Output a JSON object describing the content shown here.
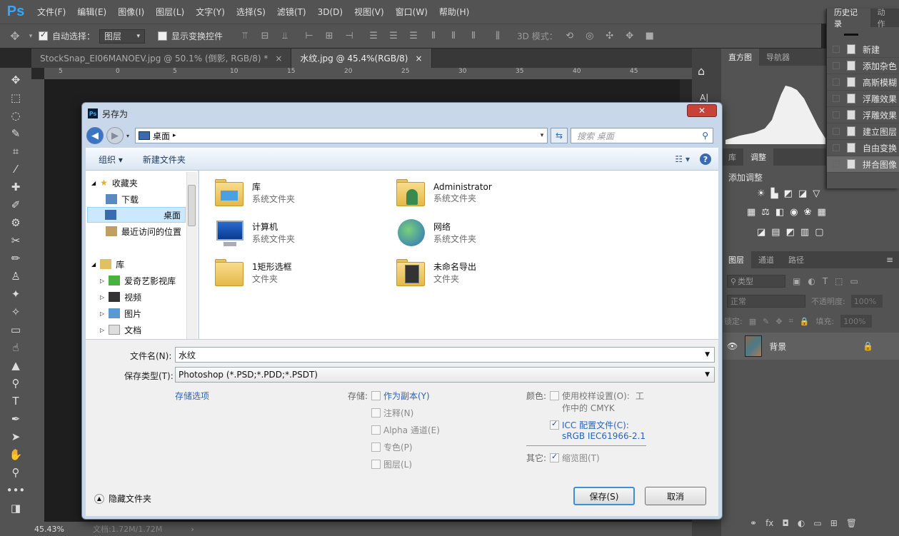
{
  "app": {
    "logo": "Ps"
  },
  "menu": [
    "文件(F)",
    "编辑(E)",
    "图像(I)",
    "图层(L)",
    "文字(Y)",
    "选择(S)",
    "滤镜(T)",
    "3D(D)",
    "视图(V)",
    "窗口(W)",
    "帮助(H)"
  ],
  "options": {
    "auto_select_label": "自动选择：",
    "auto_select_value": "图层",
    "show_transform_label": "显示变换控件",
    "mode_3d_label": "3D 模式："
  },
  "tabs": [
    {
      "title": "StockSnap_EI06MANOEV.jpg @ 50.1% (倒影, RGB/8) *"
    },
    {
      "title": "水纹.jpg @ 45.4%(RGB/8)"
    }
  ],
  "ruler": [
    "5",
    "0",
    "5",
    "10",
    "15",
    "20",
    "25",
    "30",
    "35",
    "40",
    "45"
  ],
  "status": {
    "zoom": "45.43%",
    "doc": "文档:1.72M/1.72M"
  },
  "panels": {
    "history_tab": "历史记录",
    "actions_tab": "动作",
    "histogram_tab": "直方图",
    "navigator_tab": "导航器",
    "library_tab": "库",
    "adjust_tab": "调整",
    "add_adjust": "添加调整",
    "layers_tab": "图层",
    "channels_tab": "通道",
    "paths_tab": "路径",
    "kind_label": "类型",
    "blend_mode": "正常",
    "opacity_label": "不透明度:",
    "opacity_value": "100%",
    "lock_label": "锁定:",
    "fill_label": "填充:",
    "fill_value": "100%",
    "layer_name": "背景"
  },
  "history": [
    "新建",
    "添加杂色",
    "高斯模糊",
    "浮雕效果",
    "浮雕效果",
    "建立图层",
    "自由变换",
    "拼合图像"
  ],
  "dialog": {
    "title": "另存为",
    "address": "桌面",
    "search_placeholder": "搜索 桌面",
    "organize": "组织 ▾",
    "new_folder": "新建文件夹",
    "nav": {
      "favorites": "收藏夹",
      "download": "下载",
      "desktop": "桌面",
      "recent": "最近访问的位置",
      "library": "库",
      "iqiyi": "爱奇艺影视库",
      "video": "视频",
      "pictures": "图片",
      "docs": "文档"
    },
    "files": [
      {
        "name": "库",
        "type": "系统文件夹"
      },
      {
        "name": "Administrator",
        "type": "系统文件夹"
      },
      {
        "name": "计算机",
        "type": "系统文件夹"
      },
      {
        "name": "网络",
        "type": "系统文件夹"
      },
      {
        "name": "1矩形选框",
        "type": "文件夹"
      },
      {
        "name": "未命名导出",
        "type": "文件夹"
      }
    ],
    "filename_label": "文件名(N):",
    "filename": "水纹",
    "filetype_label": "保存类型(T):",
    "filetype": "Photoshop (*.PSD;*.PDD;*.PSDT)",
    "save_options": "存储选项",
    "save_label": "存储:",
    "as_copy": "作为副本(Y)",
    "notes": "注释(N)",
    "alpha": "Alpha 通道(E)",
    "spot": "专色(P)",
    "layers": "图层(L)",
    "color_label": "颜色:",
    "proof": "使用校样设置(O):",
    "proof_2": "工",
    "proof_3": "作中的 CMYK",
    "icc": "ICC 配置文件(C):",
    "icc_profile": "sRGB IEC61966-2.1",
    "other_label": "其它:",
    "thumbnail": "缩览图(T)",
    "hide_folders": "隐藏文件夹",
    "save_btn": "保存(S)",
    "cancel_btn": "取消"
  }
}
